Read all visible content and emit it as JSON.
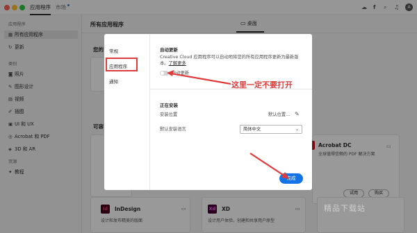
{
  "titlebar": {
    "tabs": [
      "应用程序",
      "市场"
    ],
    "icons": [
      "cloud-icon",
      "font-icon",
      "search-icon",
      "bell-icon"
    ],
    "avatar": "A"
  },
  "sidebar": {
    "section1": "应用程序",
    "items1": [
      {
        "label": "所有应用程序",
        "icon": "grid-icon"
      },
      {
        "label": "更新",
        "icon": "refresh-icon"
      }
    ],
    "section2": "类别",
    "items2": [
      {
        "label": "照片",
        "icon": "camera-icon"
      },
      {
        "label": "图形设计",
        "icon": "pen-icon"
      },
      {
        "label": "视频",
        "icon": "film-icon"
      },
      {
        "label": "插图",
        "icon": "brush-icon"
      },
      {
        "label": "UI 和 UX",
        "icon": "layout-icon"
      },
      {
        "label": "Acrobat 和 PDF",
        "icon": "acrobat-icon"
      },
      {
        "label": "3D 和 AR",
        "icon": "cube-icon"
      }
    ],
    "section3": "资源",
    "items3": [
      {
        "label": "教程",
        "icon": "lightbulb-icon"
      }
    ]
  },
  "main": {
    "title": "所有应用程序",
    "desktop_tab": "桌面",
    "behind_heading1": "您的",
    "behind_heading2": "可容",
    "cards": {
      "acrobat": {
        "name": "Acrobat DC",
        "desc": "全球值得信赖的 PDF 解决方案",
        "trial": "试用",
        "buy": "购买",
        "color": "#c4161c"
      },
      "indesign": {
        "name": "InDesign",
        "desc": "设计和发布精美的版面",
        "color": "#ff3366"
      },
      "xd": {
        "name": "XD",
        "desc": "设计用户体验，创建和共享用户原型",
        "color": "#ff61f6"
      }
    }
  },
  "dialog": {
    "nav": [
      "常规",
      "应用程序",
      "通知"
    ],
    "auto_update": {
      "heading": "自动更新",
      "desc1": "Creative Cloud 应用程序可以自动地将您的所有应用程序更新为最新版",
      "desc2": "本。",
      "learn_more": "了解更多",
      "toggle_label": "自动更新",
      "toggle_on": false
    },
    "installing": {
      "heading": "正在安装",
      "location_label": "安装位置",
      "location_value": "默认位置...",
      "language_label": "默认安装语言",
      "language_value": "简体中文"
    },
    "done": "完成"
  },
  "annotation": {
    "text": "这里一定不要打开",
    "color": "#e03a3a"
  },
  "watermark": "精品下载站"
}
